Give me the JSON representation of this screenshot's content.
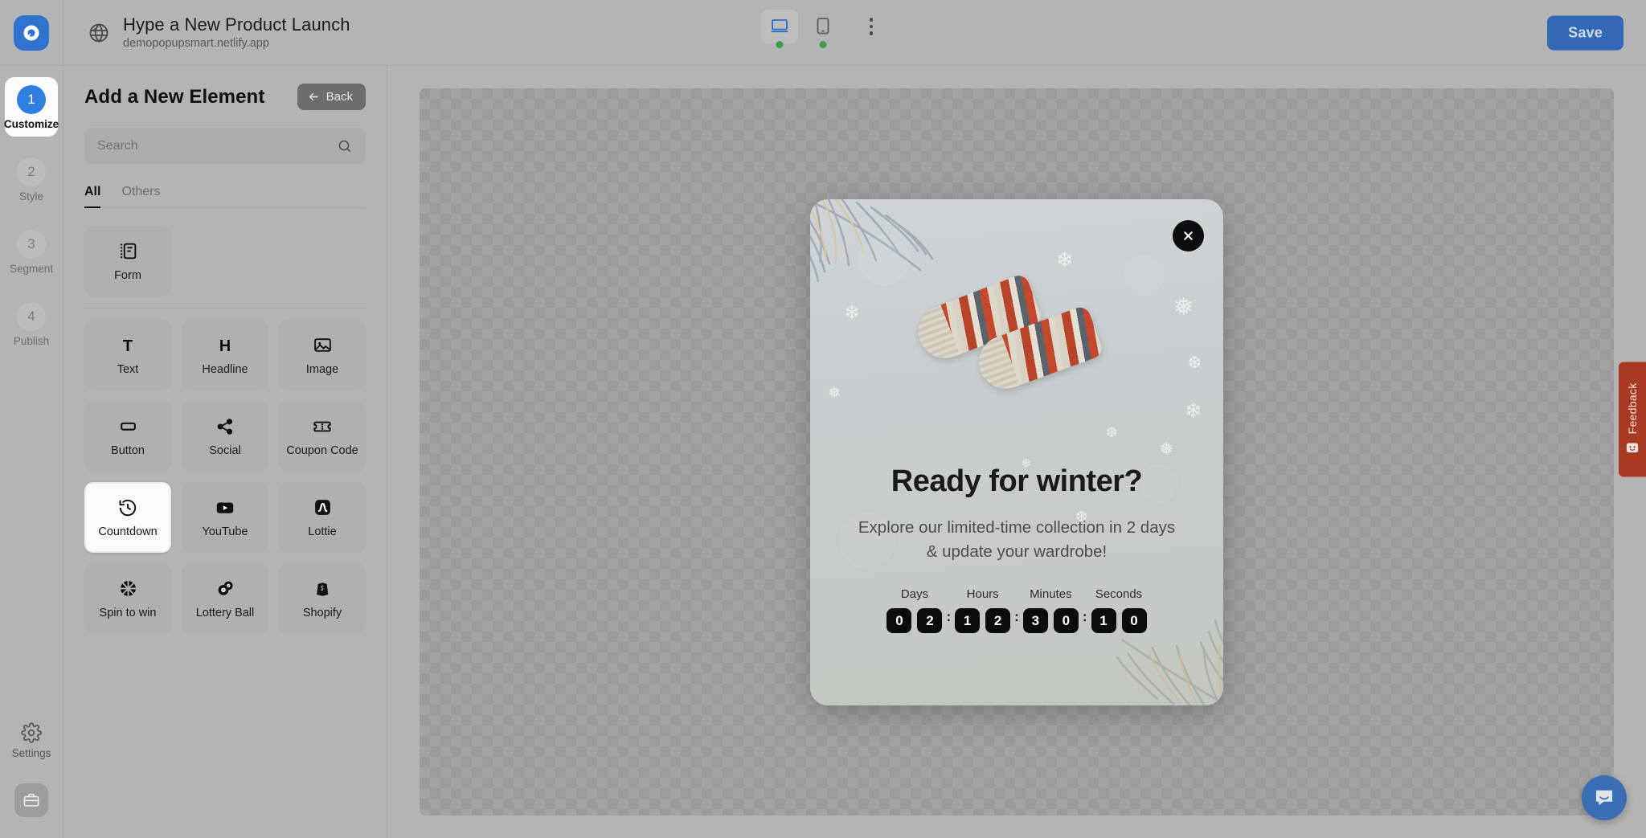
{
  "topbar": {
    "logo_icon": "popupsmart-logo-icon",
    "globe_icon": "globe-icon",
    "project_title": "Hype a New Product Launch",
    "project_url": "demopopupsmart.netlify.app",
    "devices": [
      {
        "name": "desktop",
        "icon": "desktop-icon",
        "active": true,
        "status_dot": "#3c9e4e"
      },
      {
        "name": "mobile",
        "icon": "mobile-icon",
        "active": false,
        "status_dot": "#3c9e4e"
      }
    ],
    "more_icon": "kebab-menu-icon",
    "save_label": "Save",
    "save_color": "#3268b5"
  },
  "rail": {
    "steps": [
      {
        "num": "1",
        "label": "Customize",
        "active": true
      },
      {
        "num": "2",
        "label": "Style",
        "active": false
      },
      {
        "num": "3",
        "label": "Segment",
        "active": false
      },
      {
        "num": "4",
        "label": "Publish",
        "active": false
      }
    ],
    "settings_label": "Settings",
    "settings_icon": "gear-icon",
    "briefcase_icon": "briefcase-icon",
    "active_accent": "#2f7fe0"
  },
  "panel": {
    "title": "Add a New Element",
    "back_label": "Back",
    "back_icon": "arrow-left-icon",
    "search_placeholder": "Search",
    "search_value": "",
    "search_icon": "search-icon",
    "tabs": [
      {
        "label": "All",
        "active": true
      },
      {
        "label": "Others",
        "active": false
      }
    ],
    "featured": [
      {
        "label": "Form",
        "icon": "form-icon",
        "selected": false
      }
    ],
    "elements": [
      {
        "label": "Text",
        "icon": "text-t-icon",
        "selected": false
      },
      {
        "label": "Headline",
        "icon": "headline-h-icon",
        "selected": false
      },
      {
        "label": "Image",
        "icon": "image-icon",
        "selected": false
      },
      {
        "label": "Button",
        "icon": "button-icon",
        "selected": false
      },
      {
        "label": "Social",
        "icon": "share-social-icon",
        "selected": false
      },
      {
        "label": "Coupon Code",
        "icon": "ticket-coupon-icon",
        "selected": false
      },
      {
        "label": "Countdown",
        "icon": "countdown-clock-icon",
        "selected": true
      },
      {
        "label": "YouTube",
        "icon": "youtube-icon",
        "selected": false
      },
      {
        "label": "Lottie",
        "icon": "lottie-icon",
        "selected": false
      },
      {
        "label": "Spin to win",
        "icon": "spin-wheel-icon",
        "selected": false
      },
      {
        "label": "Lottery Ball",
        "icon": "lottery-ball-icon",
        "selected": false
      },
      {
        "label": "Shopify",
        "icon": "shopify-bag-icon",
        "selected": false
      }
    ]
  },
  "popup": {
    "close_icon": "close-x-icon",
    "headline": "Ready for winter?",
    "subtext": "Explore our limited-time collection in 2 days & update your wardrobe!",
    "hero_image": "winter-mittens-photo",
    "countdown": {
      "units": [
        {
          "label": "Days",
          "digits": [
            "0",
            "2"
          ]
        },
        {
          "label": "Hours",
          "digits": [
            "1",
            "2"
          ]
        },
        {
          "label": "Minutes",
          "digits": [
            "3",
            "0"
          ]
        },
        {
          "label": "Seconds",
          "digits": [
            "1",
            "0"
          ]
        }
      ],
      "separator": ":"
    }
  },
  "feedback": {
    "label": "Feedback",
    "icon": "smiley-face-icon",
    "color": "#a83a22"
  },
  "chat": {
    "icon": "chat-bubble-icon",
    "color": "#3b6fb5"
  }
}
